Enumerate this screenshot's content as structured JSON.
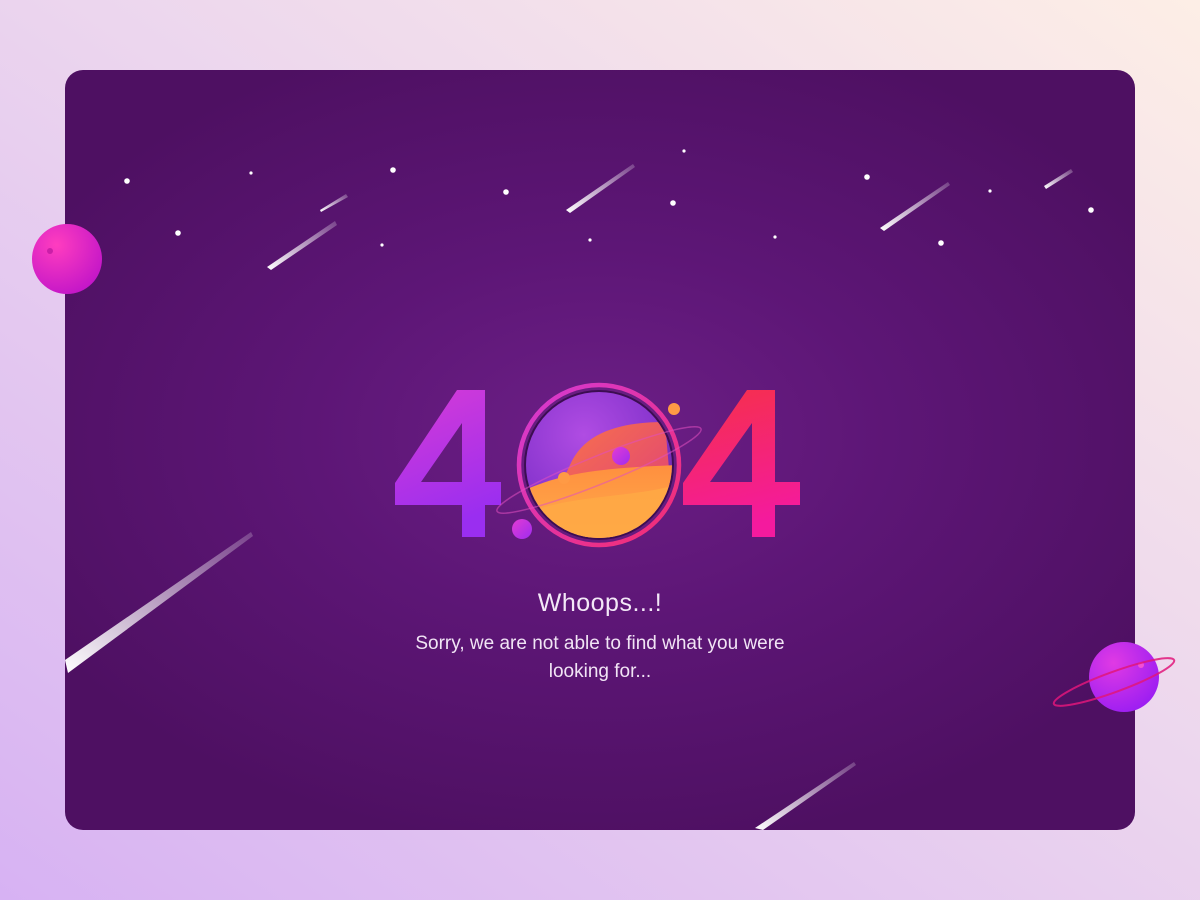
{
  "error": {
    "code_digit_left": "4",
    "code_digit_right": "4",
    "graphic": "planet-zero-icon",
    "headline": "Whoops...!",
    "message": "Sorry, we are not able to find what you were looking for..."
  },
  "colors": {
    "page_gradient_start": "#fdeee6",
    "page_gradient_end": "#d7b2f3",
    "card_background": "#5d1676",
    "digit_left_gradient": [
      "#d13ad8",
      "#9a2cf2"
    ],
    "digit_right_gradient": [
      "#f22c4a",
      "#f41c9d"
    ],
    "planet_fill": "#ff9b45",
    "text": "#f3e8f7"
  },
  "decorations": [
    "star-icon",
    "shooting-star-icon",
    "planet-icon",
    "ringed-planet-icon"
  ]
}
